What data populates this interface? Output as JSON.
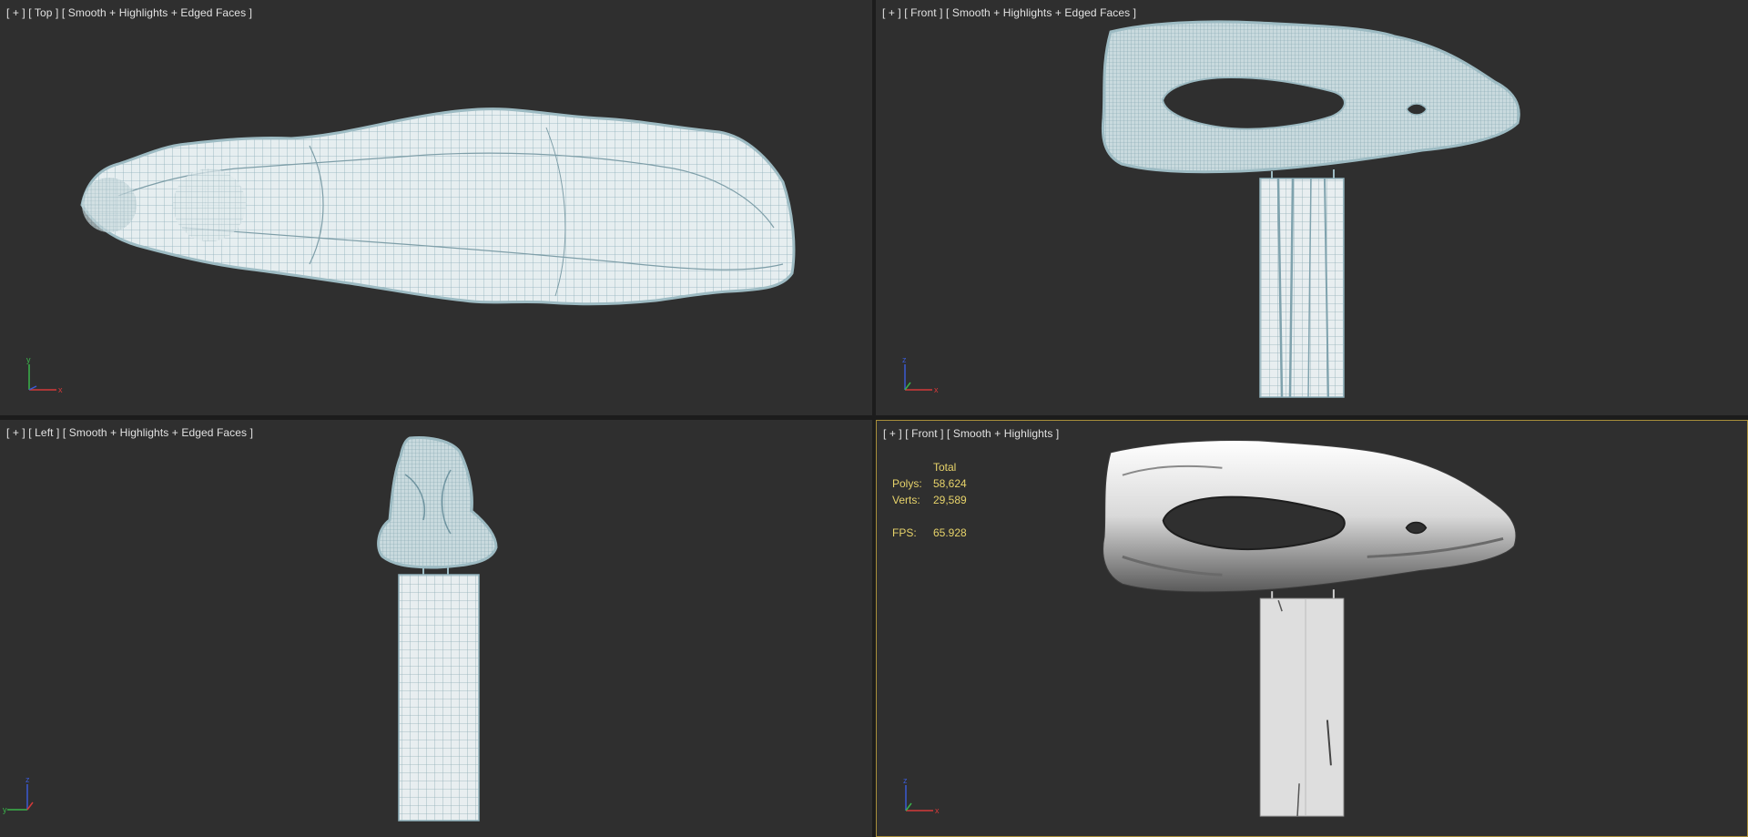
{
  "viewports": {
    "top": {
      "plus": "[ + ]",
      "view": "[ Top ]",
      "shading": "[ Smooth + Highlights + Edged Faces ]"
    },
    "front": {
      "plus": "[ + ]",
      "view": "[ Front ]",
      "shading": "[ Smooth + Highlights + Edged Faces ]"
    },
    "left": {
      "plus": "[ + ]",
      "view": "[ Left ]",
      "shading": "[ Smooth + Highlights + Edged Faces ]"
    },
    "perspective_front": {
      "plus": "[ + ]",
      "view": "[ Front ]",
      "shading": "[ Smooth + Highlights ]"
    }
  },
  "stats": {
    "header": "Total",
    "polys_label": "Polys:",
    "polys_value": "58,624",
    "verts_label": "Verts:",
    "verts_value": "29,589",
    "fps_label": "FPS:",
    "fps_value": "65.928"
  },
  "gizmo_labels": {
    "top": {
      "a": "y",
      "b": "x"
    },
    "front": {
      "a": "z",
      "b": "x"
    },
    "left": {
      "a": "z",
      "b": "y"
    },
    "perspective_front": {
      "a": "z",
      "b": "x"
    }
  },
  "colors": {
    "viewport_bg": "#2f2f2f",
    "active_border": "#a88e3a",
    "wire_fill": "#e4ecee",
    "wire_line": "#8fb1bb",
    "stats_text": "#e7d36a",
    "axis_x": "#d33a3a",
    "axis_y": "#3ab34a",
    "axis_z": "#3a5ad3"
  }
}
